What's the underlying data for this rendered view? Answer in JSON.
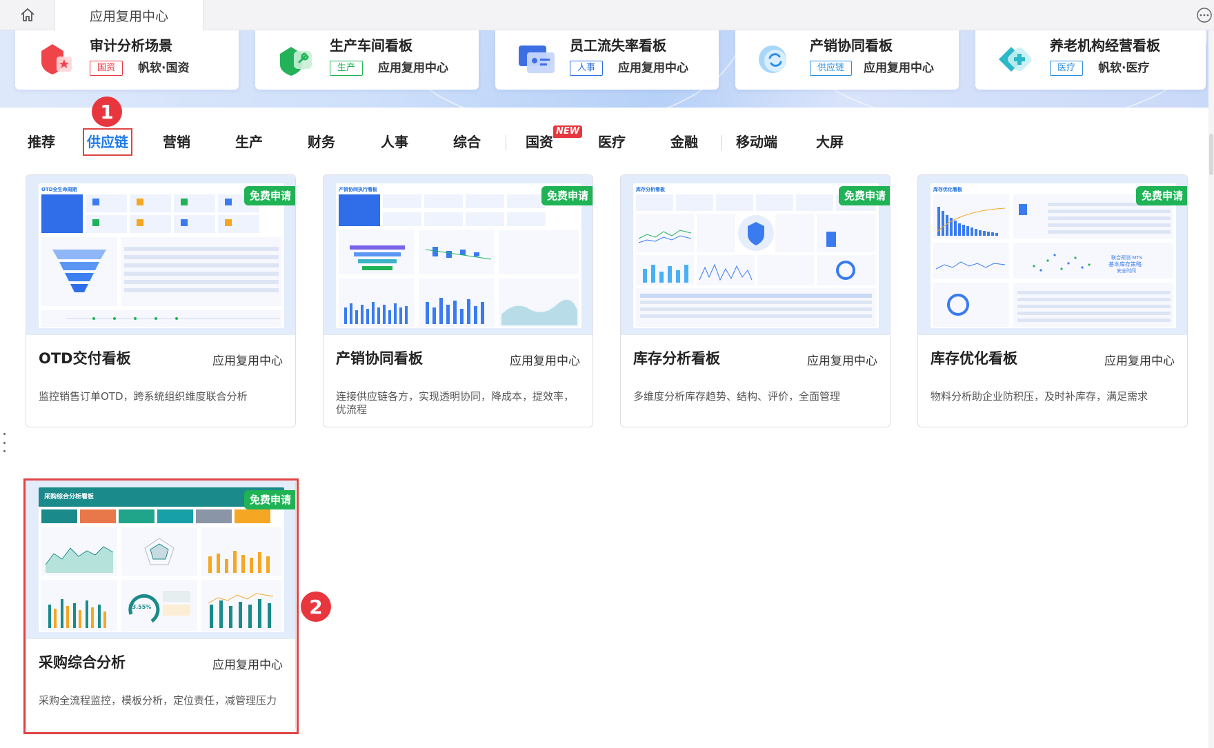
{
  "tabbar": {
    "app_tab": "应用复用中心"
  },
  "banner_scenes": [
    {
      "title": "审计分析场景",
      "badge": "国资",
      "source": "帆软·国资",
      "badge_color": "#e8363e"
    },
    {
      "title": "生产车间看板",
      "badge": "生产",
      "source": "应用复用中心",
      "badge_color": "#1fb356"
    },
    {
      "title": "员工流失率看板",
      "badge": "人事",
      "source": "应用复用中心",
      "badge_color": "#2a6fe0"
    },
    {
      "title": "产销协同看板",
      "badge": "供应链",
      "source": "应用复用中心",
      "badge_color": "#2a8fe0"
    },
    {
      "title": "养老机构经营看板",
      "badge": "医疗",
      "source": "帆软·医疗",
      "badge_color": "#2a8fe0"
    }
  ],
  "categories": [
    "推荐",
    "供应链",
    "营销",
    "生产",
    "财务",
    "人事",
    "综合",
    "国资",
    "医疗",
    "金融",
    "移动端",
    "大屏"
  ],
  "new_badge": "NEW",
  "steps": [
    "1",
    "2"
  ],
  "free_label": "免费申请",
  "cards": [
    {
      "name": "OTD交付看板",
      "source": "应用复用中心",
      "desc": "监控销售订单OTD，跨系统组织维度联合分析",
      "thumb_title": "OTD全生命周期"
    },
    {
      "name": "产销协同看板",
      "source": "应用复用中心",
      "desc": "连接供应链各方，实现透明协同，降成本，提效率，优流程",
      "thumb_title": "产销协同执行看板"
    },
    {
      "name": "库存分析看板",
      "source": "应用复用中心",
      "desc": "多维度分析库存趋势、结构、评价，全面管理",
      "thumb_title": "库存分析看板"
    },
    {
      "name": "库存优化看板",
      "source": "应用复用中心",
      "desc": "物料分析助企业防积压，及时补库存，满足需求",
      "thumb_title": "库存优化看板"
    },
    {
      "name": "采购综合分析",
      "source": "应用复用中心",
      "desc": "采购全流程监控，模板分析，定位责任，减管理压力",
      "thumb_title": "采购综合分析看板",
      "thumb_gauge": "73.55%"
    }
  ],
  "colors": {
    "accent": "#1f7be8",
    "highlight": "#e04343",
    "free_badge": "#1fb356",
    "step": "#e8363e"
  }
}
